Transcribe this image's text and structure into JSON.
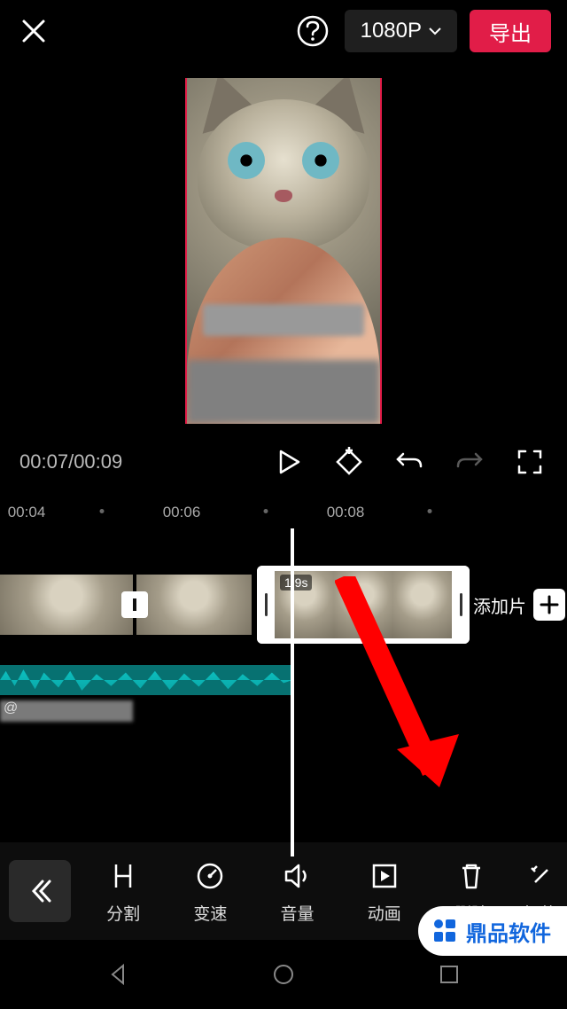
{
  "header": {
    "resolution": "1080P",
    "export_label": "导出"
  },
  "transport": {
    "current_time": "00:07",
    "total_time": "00:09"
  },
  "ruler": {
    "labels": [
      "00:04",
      "00:06",
      "00:08"
    ]
  },
  "timeline": {
    "selected_clip_duration": "1.9s",
    "add_segment_label": "添加片",
    "audio_credit_prefix": "@"
  },
  "tools": {
    "split": "分割",
    "speed": "变速",
    "volume": "音量",
    "animation": "动画",
    "delete": "删除",
    "smart": "智能"
  },
  "watermark": {
    "text": "鼎品软件"
  }
}
